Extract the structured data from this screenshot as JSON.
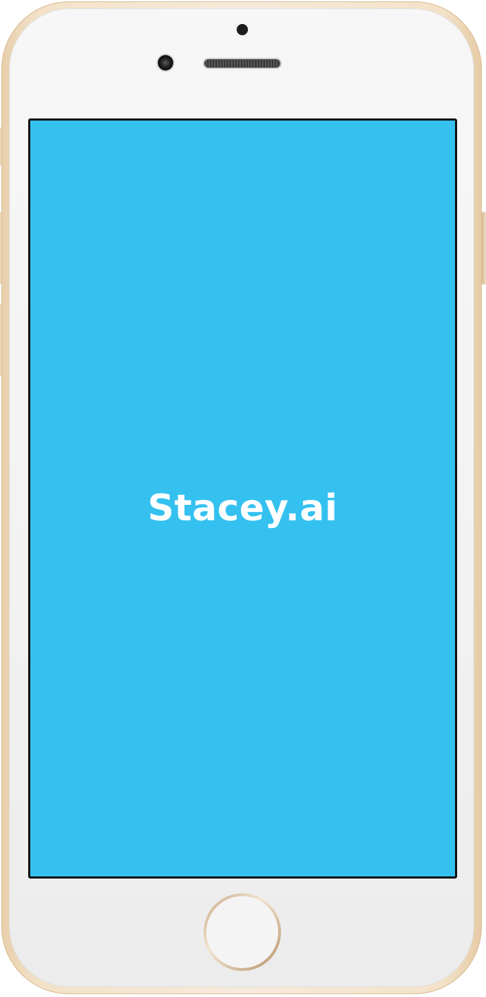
{
  "device": {
    "frame_color": "#f3e2c8",
    "face_color": "#f3f3f3"
  },
  "screen": {
    "background_color": "#34c1f0",
    "app_name": "Stacey.ai",
    "text_color": "#ffffff"
  }
}
